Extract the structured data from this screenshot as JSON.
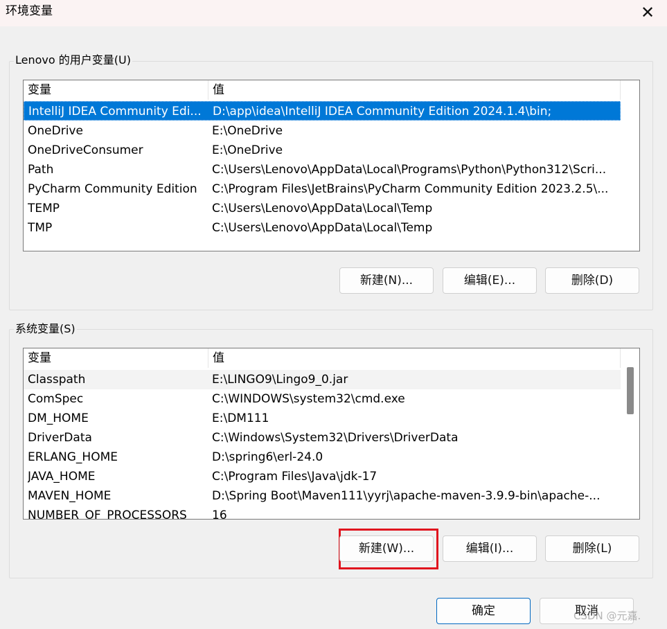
{
  "window": {
    "title": "环境变量",
    "close_glyph": "✕"
  },
  "user_vars": {
    "legend": "Lenovo 的用户变量(U)",
    "columns": [
      "变量",
      "值"
    ],
    "rows": [
      {
        "name": "IntelliJ IDEA Community Edi...",
        "value": "D:\\app\\idea\\IntelliJ IDEA Community Edition 2024.1.4\\bin;"
      },
      {
        "name": "OneDrive",
        "value": "E:\\OneDrive"
      },
      {
        "name": "OneDriveConsumer",
        "value": "E:\\OneDrive"
      },
      {
        "name": "Path",
        "value": "C:\\Users\\Lenovo\\AppData\\Local\\Programs\\Python\\Python312\\Scri..."
      },
      {
        "name": "PyCharm Community Edition",
        "value": "C:\\Program Files\\JetBrains\\PyCharm Community Edition 2023.2.5\\..."
      },
      {
        "name": "TEMP",
        "value": "C:\\Users\\Lenovo\\AppData\\Local\\Temp"
      },
      {
        "name": "TMP",
        "value": "C:\\Users\\Lenovo\\AppData\\Local\\Temp"
      }
    ],
    "buttons": {
      "new": "新建(N)...",
      "edit": "编辑(E)...",
      "delete": "删除(D)"
    }
  },
  "system_vars": {
    "legend": "系统变量(S)",
    "columns": [
      "变量",
      "值"
    ],
    "rows": [
      {
        "name": "Classpath",
        "value": "E:\\LINGO9\\Lingo9_0.jar"
      },
      {
        "name": "ComSpec",
        "value": "C:\\WINDOWS\\system32\\cmd.exe"
      },
      {
        "name": "DM_HOME",
        "value": "E:\\DM111"
      },
      {
        "name": "DriverData",
        "value": "C:\\Windows\\System32\\Drivers\\DriverData"
      },
      {
        "name": "ERLANG_HOME",
        "value": "D:\\spring6\\erl-24.0"
      },
      {
        "name": "JAVA_HOME",
        "value": "C:\\Program Files\\Java\\jdk-17"
      },
      {
        "name": "MAVEN_HOME",
        "value": "D:\\Spring Boot\\Maven111\\yyrj\\apache-maven-3.9.9-bin\\apache-..."
      },
      {
        "name": "NUMBER_OF_PROCESSORS",
        "value": "16"
      }
    ],
    "buttons": {
      "new": "新建(W)...",
      "edit": "编辑(I)...",
      "delete": "删除(L)"
    }
  },
  "footer": {
    "ok": "确定",
    "cancel": "取消"
  },
  "watermark": "CSDN @元嘉.",
  "colors": {
    "selection": "#0078d7",
    "highlight_box": "#e0141e",
    "primary_border": "#0067c0"
  }
}
